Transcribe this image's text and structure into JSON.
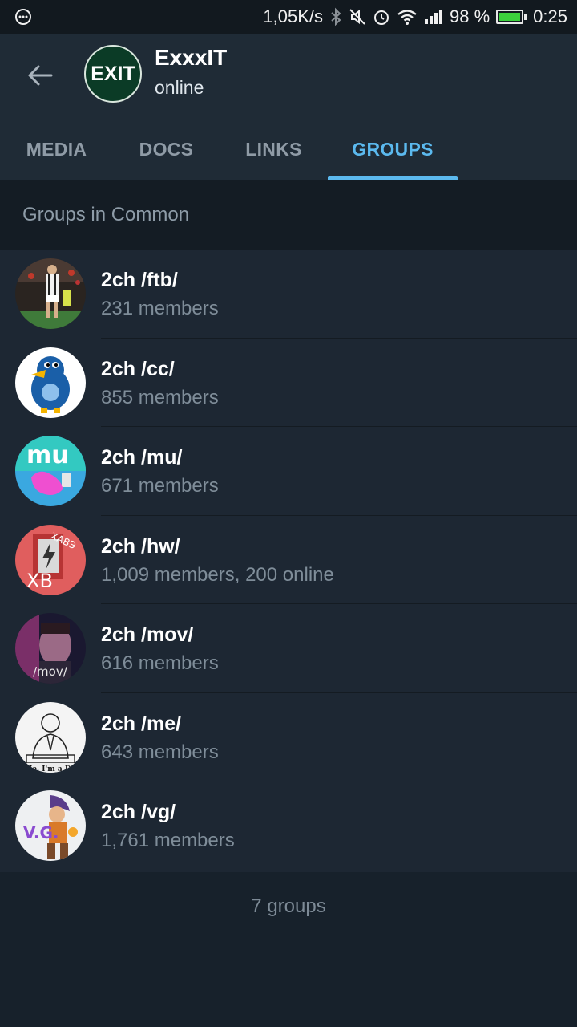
{
  "status_bar": {
    "speed": "1,05K/s",
    "battery_level": "98 %",
    "battery_fraction": 0.98,
    "time": "0:25"
  },
  "profile": {
    "avatar_text": "EXIT",
    "name": "ExxxIT",
    "status": "online"
  },
  "tabs": [
    {
      "label": "MEDIA",
      "active": false
    },
    {
      "label": "DOCS",
      "active": false
    },
    {
      "label": "LINKS",
      "active": false
    },
    {
      "label": "GROUPS",
      "active": true
    }
  ],
  "section_title": "Groups in Common",
  "groups": [
    {
      "title": "2ch /ftb/",
      "subtitle": "231 members"
    },
    {
      "title": "2ch /cc/",
      "subtitle": "855 members"
    },
    {
      "title": "2ch /mu/",
      "subtitle": "671 members",
      "avatar_text": "mu"
    },
    {
      "title": "2ch /hw/",
      "subtitle": "1,009 members, 200 online",
      "avatar_text": "XB",
      "avatar_text2": "ХАВЭ"
    },
    {
      "title": "2ch /mov/",
      "subtitle": "616 members",
      "avatar_text": "/mov/"
    },
    {
      "title": "2ch /me/",
      "subtitle": "643 members",
      "avatar_text": "I Me, I'm a D"
    },
    {
      "title": "2ch /vg/",
      "subtitle": "1,761 members",
      "avatar_text": "V.G."
    }
  ],
  "footer": "7 groups",
  "colors": {
    "background": "#17212b",
    "header": "#1f2b36",
    "accent": "#5bb9ee",
    "row": "#1d2733",
    "muted_text": "#7f8d99"
  }
}
